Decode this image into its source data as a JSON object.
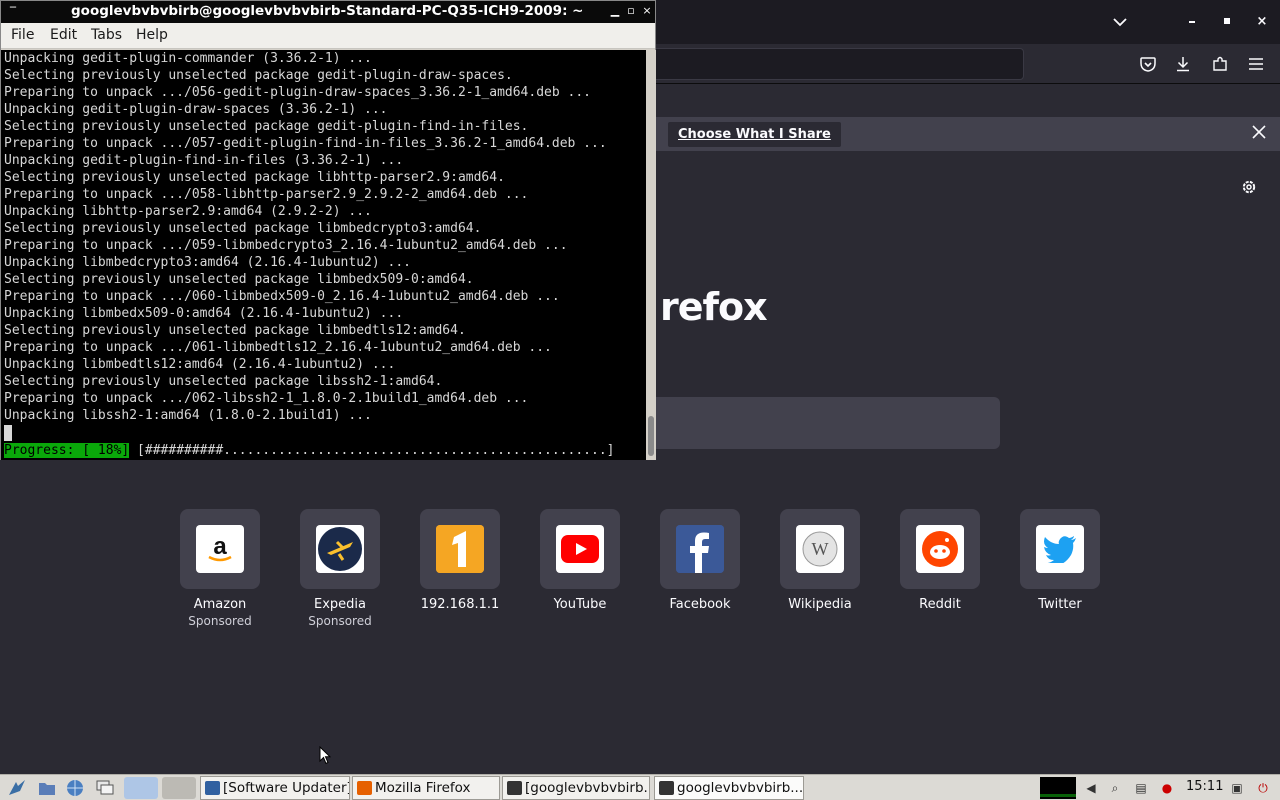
{
  "firefox": {
    "notification": {
      "share_button_label": "Choose What I Share"
    },
    "brand_text": "refox",
    "tiles": [
      {
        "label": "Amazon",
        "sub": "Sponsored",
        "icon": "amazon-icon",
        "bg": "#ffffff",
        "fg": "#111111"
      },
      {
        "label": "Expedia",
        "sub": "Sponsored",
        "icon": "expedia-icon",
        "bg": "#ffffff",
        "fg": "#fbc02d"
      },
      {
        "label": "192.168.1.1",
        "sub": "",
        "icon": "number-one-icon",
        "bg": "#f5a623",
        "fg": "#ffffff"
      },
      {
        "label": "YouTube",
        "sub": "",
        "icon": "youtube-icon",
        "bg": "#ffffff",
        "fg": "#ff0000"
      },
      {
        "label": "Facebook",
        "sub": "",
        "icon": "facebook-icon",
        "bg": "#3b5998",
        "fg": "#ffffff"
      },
      {
        "label": "Wikipedia",
        "sub": "",
        "icon": "wikipedia-icon",
        "bg": "#ffffff",
        "fg": "#888888"
      },
      {
        "label": "Reddit",
        "sub": "",
        "icon": "reddit-icon",
        "bg": "#ffffff",
        "fg": "#ff4500"
      },
      {
        "label": "Twitter",
        "sub": "",
        "icon": "twitter-icon",
        "bg": "#ffffff",
        "fg": "#1da1f2"
      }
    ]
  },
  "terminal": {
    "title": "googlevbvbvbirb@googlevbvbvbirb-Standard-PC-Q35-ICH9-2009: ~",
    "menu": [
      "File",
      "Edit",
      "Tabs",
      "Help"
    ],
    "lines": [
      "Unpacking gedit-plugin-commander (3.36.2-1) ...",
      "Selecting previously unselected package gedit-plugin-draw-spaces.",
      "Preparing to unpack .../056-gedit-plugin-draw-spaces_3.36.2-1_amd64.deb ...",
      "Unpacking gedit-plugin-draw-spaces (3.36.2-1) ...",
      "Selecting previously unselected package gedit-plugin-find-in-files.",
      "Preparing to unpack .../057-gedit-plugin-find-in-files_3.36.2-1_amd64.deb ...",
      "Unpacking gedit-plugin-find-in-files (3.36.2-1) ...",
      "Selecting previously unselected package libhttp-parser2.9:amd64.",
      "Preparing to unpack .../058-libhttp-parser2.9_2.9.2-2_amd64.deb ...",
      "Unpacking libhttp-parser2.9:amd64 (2.9.2-2) ...",
      "Selecting previously unselected package libmbedcrypto3:amd64.",
      "Preparing to unpack .../059-libmbedcrypto3_2.16.4-1ubuntu2_amd64.deb ...",
      "Unpacking libmbedcrypto3:amd64 (2.16.4-1ubuntu2) ...",
      "Selecting previously unselected package libmbedx509-0:amd64.",
      "Preparing to unpack .../060-libmbedx509-0_2.16.4-1ubuntu2_amd64.deb ...",
      "Unpacking libmbedx509-0:amd64 (2.16.4-1ubuntu2) ...",
      "Selecting previously unselected package libmbedtls12:amd64.",
      "Preparing to unpack .../061-libmbedtls12_2.16.4-1ubuntu2_amd64.deb ...",
      "Unpacking libmbedtls12:amd64 (2.16.4-1ubuntu2) ...",
      "Selecting previously unselected package libssh2-1:amd64.",
      "Preparing to unpack .../062-libssh2-1_1.8.0-2.1build1_amd64.deb ...",
      "Unpacking libssh2-1:amd64 (1.8.0-2.1build1) ..."
    ],
    "progress_label": "Progress: [ 18%]",
    "progress_bar": " [##########.................................................]",
    "progress_fraction": 0.18
  },
  "taskbar": {
    "tasks": [
      {
        "label": "[Software Updater]",
        "icon": "software-updater-icon",
        "color": "#3060a0"
      },
      {
        "label": "Mozilla Firefox",
        "icon": "firefox-icon",
        "color": "#e66000"
      },
      {
        "label": "[googlevbvbvbirb...",
        "icon": "terminal-icon",
        "color": "#333333"
      },
      {
        "label": "googlevbvbvbirb...",
        "icon": "terminal-icon",
        "color": "#333333"
      }
    ],
    "clock": "15:11"
  }
}
